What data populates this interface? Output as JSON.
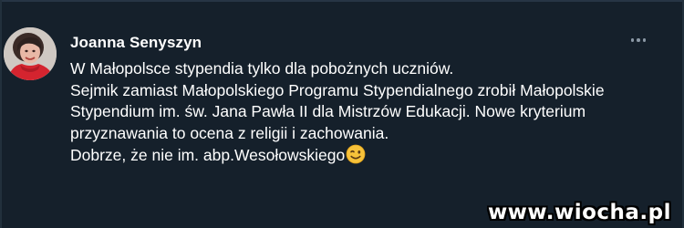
{
  "theme": {
    "background": "#15202b",
    "text_primary": "#ffffff",
    "text_secondary": "#8b98a5",
    "divider": "#273545"
  },
  "tweet": {
    "author_name": "Joanna Senyszyn",
    "avatar_icon": "profile-photo",
    "more_icon": "ellipsis-icon",
    "lines": [
      "W Małopolsce stypendia tylko dla pobożnych uczniów.",
      "Sejmik zamiast Małopolskiego Programu Stypendialnego zrobił Małopolskie",
      "Stypendium im. św. Jana Pawła II dla Mistrzów Edukacji. Nowe kryterium",
      "przyznawania to ocena z religii i zachowania.",
      "Dobrze, że nie im. abp.Wesołowskiego"
    ],
    "emoji_icon": "winking-face-emoji"
  },
  "watermark": {
    "text": "www.wiocha.pl"
  }
}
